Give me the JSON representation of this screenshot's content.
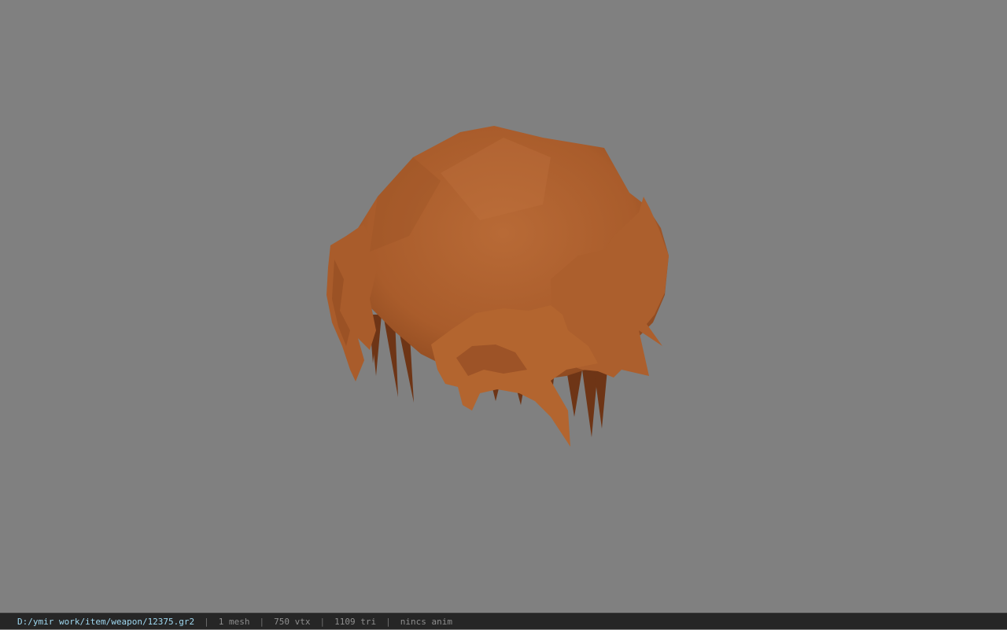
{
  "viewer": {
    "background_color": "#808080",
    "model_color": "#b0612f",
    "model_shadow_color": "#6e3516"
  },
  "status": {
    "file_path": "D:/ymir work/item/weapon/12375.gr2",
    "mesh_count": "1 mesh",
    "vertex_count": "750 vtx",
    "triangle_count": "1109 tri",
    "animation": "nincs anim",
    "separator": "|"
  }
}
